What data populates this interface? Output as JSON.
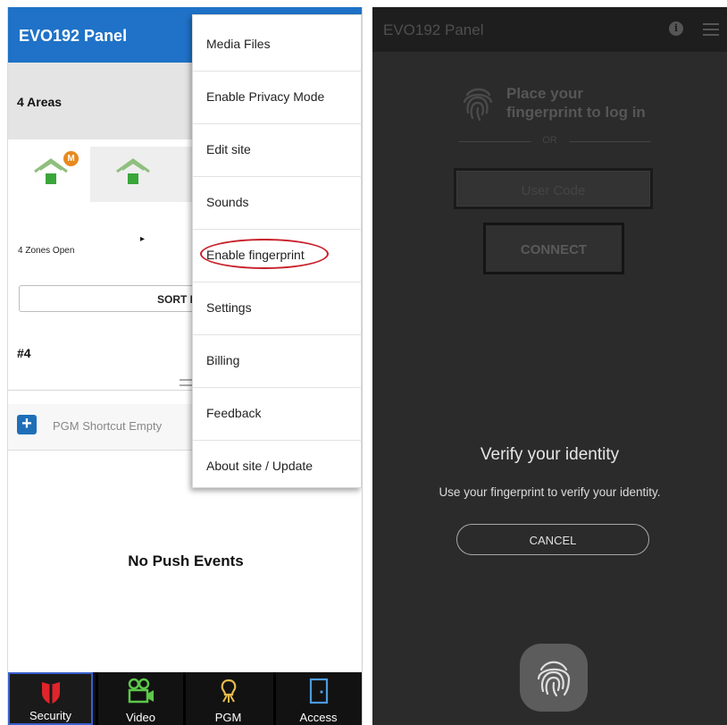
{
  "left_screen": {
    "header": {
      "title": "EVO192 Panel"
    },
    "areas": {
      "label": "4 Areas"
    },
    "zones_open": "4 Zones Open",
    "sort_by": "SORT BY",
    "area_number": "#4",
    "pgm_shortcut": {
      "icon": "plus-icon",
      "label": "PGM Shortcut Empty"
    },
    "no_events": "No Push Events",
    "badge_letter": "M",
    "menu": {
      "items": [
        {
          "label": "Media Files"
        },
        {
          "label": "Enable Privacy Mode"
        },
        {
          "label": "Edit site"
        },
        {
          "label": "Sounds"
        },
        {
          "label": "Enable fingerprint",
          "circled": true
        },
        {
          "label": "Settings"
        },
        {
          "label": "Billing"
        },
        {
          "label": "Feedback"
        },
        {
          "label": "About site / Update"
        }
      ],
      "highlight_color": "#c8202a"
    },
    "bottom_nav": [
      {
        "label": "Security",
        "icon": "shield-icon",
        "active": true
      },
      {
        "label": "Video",
        "icon": "video-camera-icon",
        "active": false
      },
      {
        "label": "PGM",
        "icon": "light-bulb-icon",
        "active": false
      },
      {
        "label": "Access",
        "icon": "door-icon",
        "active": false
      }
    ],
    "colors": {
      "header": "#1f72c7",
      "nav_bg": "#121212",
      "active_border": "#3a5fcc"
    }
  },
  "right_screen": {
    "header": {
      "title": "EVO192 Panel",
      "info_icon": "info-icon",
      "menu_icon": "hamburger-menu-icon"
    },
    "login": {
      "prompt_line1": "Place your",
      "prompt_line2": "fingerprint to log in",
      "or": "OR",
      "user_code_placeholder": "User Code",
      "connect_label": "CONNECT"
    },
    "dialog": {
      "title": "Verify your identity",
      "message": "Use your fingerprint to verify your identity.",
      "cancel_label": "CANCEL",
      "icon": "fingerprint-icon"
    }
  }
}
